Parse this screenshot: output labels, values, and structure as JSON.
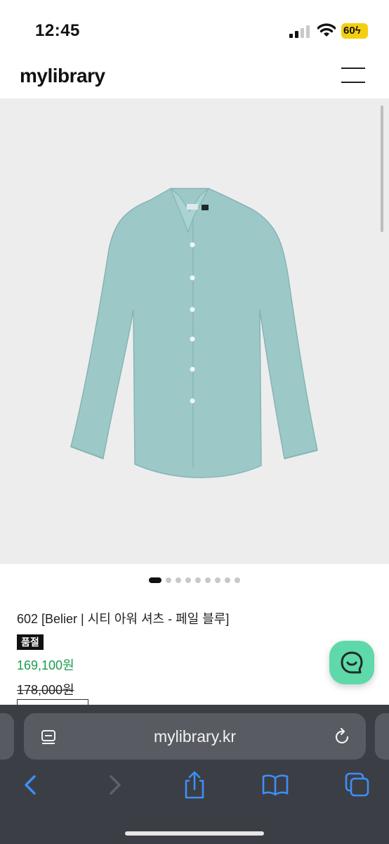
{
  "status_bar": {
    "time": "12:45",
    "battery": "60"
  },
  "header": {
    "logo": "mylibrary"
  },
  "product": {
    "image_alt": "pale blue button-up shirt",
    "color_hex": "#9cc9c8",
    "gallery": {
      "count": 9,
      "active_index": 0
    },
    "name": "602 [Belier | 시티 아워 셔츠 - 페일 블루]",
    "badge": "품절",
    "sale_price": "169,100원",
    "original_price": "178,000원"
  },
  "browser": {
    "url": "mylibrary.kr",
    "icons": [
      "reader-icon",
      "reload-icon",
      "back-icon",
      "forward-icon",
      "share-icon",
      "bookmarks-icon",
      "tabs-icon"
    ]
  },
  "colors": {
    "sale_price": "#1e9a4e",
    "chat_button": "#5fd9aa",
    "battery": "#f5cf0e",
    "browser_bg": "#3b3e45"
  }
}
